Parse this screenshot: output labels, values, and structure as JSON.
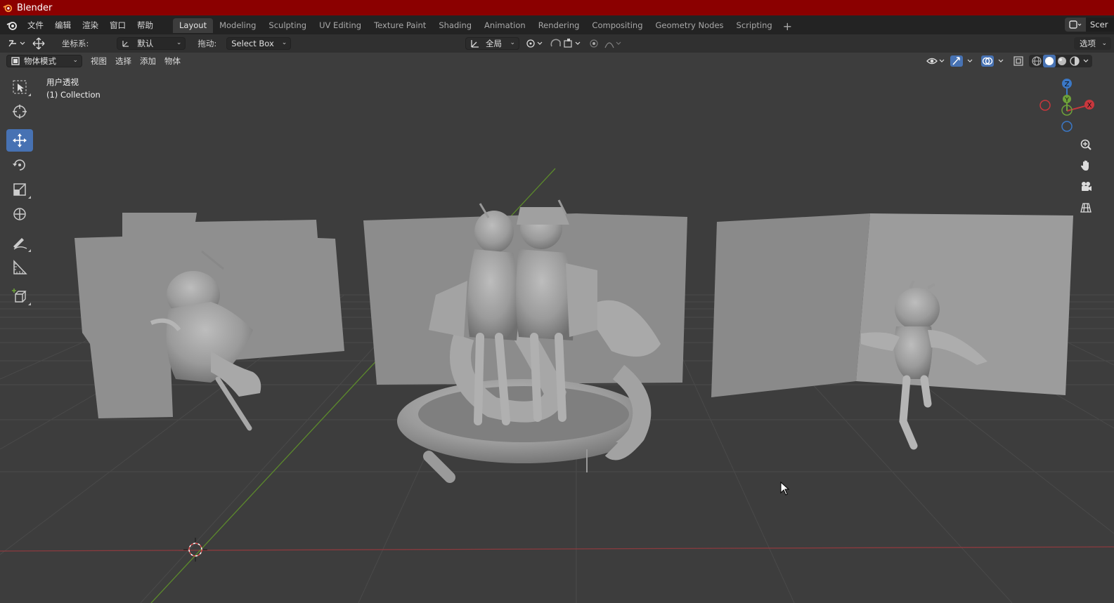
{
  "window": {
    "title": "Blender"
  },
  "menus": [
    "文件",
    "编辑",
    "渲染",
    "窗口",
    "帮助"
  ],
  "workspaces": [
    "Layout",
    "Modeling",
    "Sculpting",
    "UV Editing",
    "Texture Paint",
    "Shading",
    "Animation",
    "Rendering",
    "Compositing",
    "Geometry Nodes",
    "Scripting"
  ],
  "active_workspace": "Layout",
  "scene": {
    "label": "Scer"
  },
  "tool_settings": {
    "orientation_label": "坐标系:",
    "orientation_value": "默认",
    "drag_label": "拖动:",
    "drag_value": "Select Box",
    "transform_pivot": "全局",
    "options": "选项"
  },
  "viewport_header": {
    "mode": "物体模式",
    "menus": [
      "视图",
      "选择",
      "添加",
      "物体"
    ]
  },
  "viewport_overlay": {
    "view_name": "用户透视",
    "collection": "(1) Collection"
  },
  "gizmo_axes": {
    "z": "Z",
    "y": "Y",
    "x": "X"
  },
  "colors": {
    "titlebar": "#8b0000",
    "accent": "#4772b3",
    "x_axis": "#c8373d",
    "y_axis": "#6ea23a",
    "z_axis": "#3b78c6"
  }
}
